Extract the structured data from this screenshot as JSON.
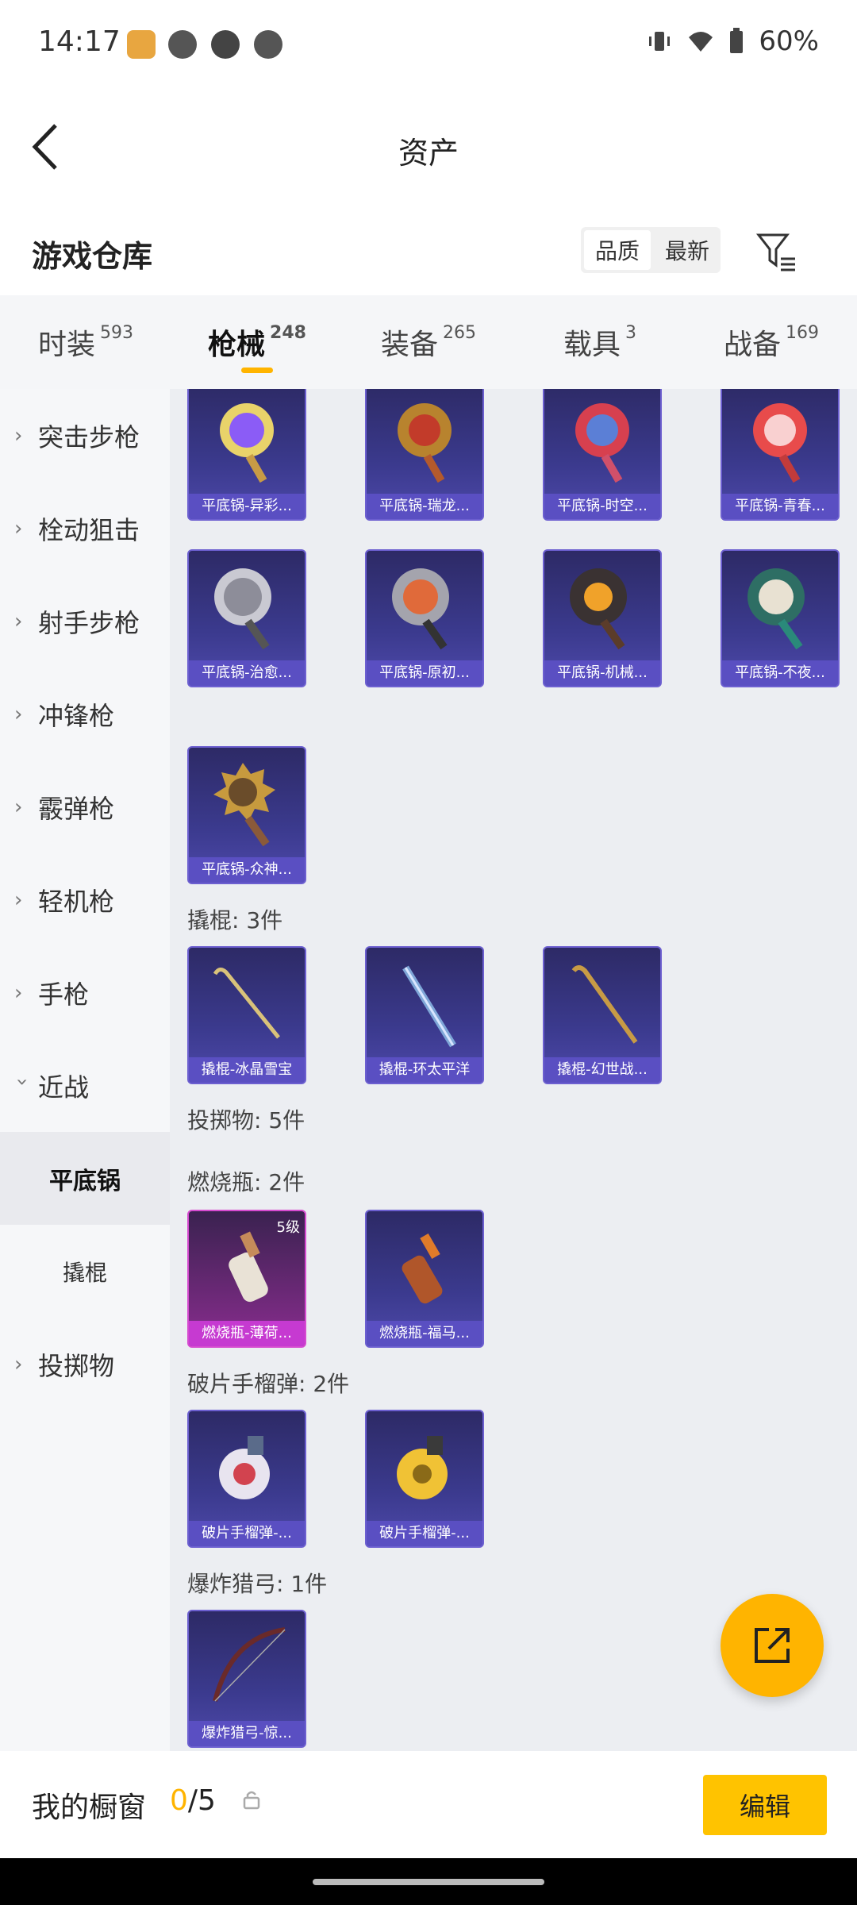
{
  "status_bar": {
    "time": "14:17",
    "battery": "60%"
  },
  "header": {
    "title": "资产"
  },
  "warehouse": {
    "title": "游戏仓库",
    "sort_options": [
      "品质",
      "最新"
    ]
  },
  "tabs": [
    {
      "label": "时装",
      "count": "593"
    },
    {
      "label": "枪械",
      "count": "248"
    },
    {
      "label": "装备",
      "count": "265"
    },
    {
      "label": "载具",
      "count": "3"
    },
    {
      "label": "战备",
      "count": "169"
    }
  ],
  "sidebar": {
    "items": [
      "突击步枪",
      "栓动狙击",
      "射手步枪",
      "冲锋枪",
      "霰弹枪",
      "轻机枪",
      "手枪",
      "近战"
    ],
    "subitems": [
      "平底锅",
      "撬棍"
    ],
    "last": "投掷物"
  },
  "content": {
    "pans_row1": [
      "平底锅-异彩...",
      "平底锅-瑞龙...",
      "平底锅-时空...",
      "平底锅-青春..."
    ],
    "pans_row2": [
      "平底锅-治愈...",
      "平底锅-原初...",
      "平底锅-机械...",
      "平底锅-不夜..."
    ],
    "pans_row3": [
      "平底锅-众神..."
    ],
    "crowbar_section": "撬棍: 3件",
    "crowbars": [
      "撬棍-冰晶雪宝",
      "撬棍-环太平洋",
      "撬棍-幻世战..."
    ],
    "throwables_section": "投掷物: 5件",
    "molotov_section": "燃烧瓶: 2件",
    "molotovs": [
      "燃烧瓶-薄荷...",
      "燃烧瓶-福马..."
    ],
    "molotov_badge": "5级",
    "frag_section": "破片手榴弹: 2件",
    "frags": [
      "破片手榴弹-...",
      "破片手榴弹-..."
    ],
    "bow_section": "爆炸猎弓: 1件",
    "bows": [
      "爆炸猎弓-惊..."
    ]
  },
  "bottom": {
    "window_label": "我的橱窗",
    "current": "0",
    "total": "/5",
    "edit": "编辑"
  },
  "colors": {
    "accent": "#ffb400",
    "card": "#3b3a8e",
    "card_label": "#5a4fc2",
    "pink_card": "#c63ad1"
  }
}
